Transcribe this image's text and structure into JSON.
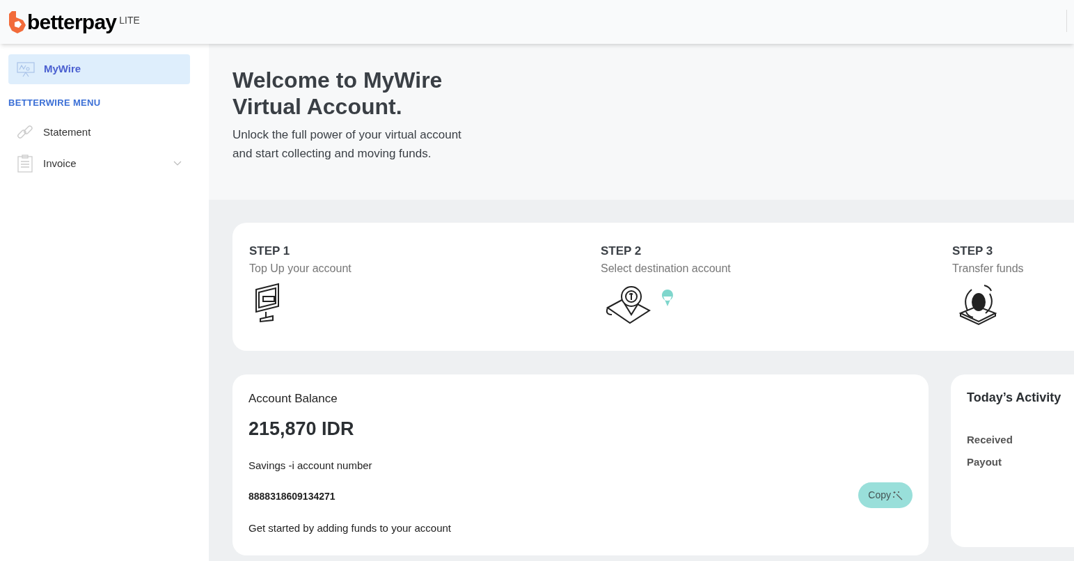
{
  "header": {
    "logo": "betterpay",
    "edition": "LITE"
  },
  "sidebar": {
    "items": [
      {
        "label": "MyWire",
        "kind": "dashboard",
        "selected": true
      }
    ],
    "section_title": "BETTERWIRE MENU",
    "menu": [
      {
        "label": "Statement",
        "kind": "link",
        "selected": false,
        "expandable": false
      },
      {
        "label": "Invoice",
        "kind": "document",
        "selected": false,
        "expandable": true
      }
    ]
  },
  "hero": {
    "title": "Welcome to MyWire Virtual Account.",
    "subtitle": "Unlock the full power of your virtual account and start collecting and moving funds."
  },
  "steps": [
    {
      "title": "STEP 1",
      "text": "Top Up your account",
      "kind": "monitor"
    },
    {
      "title": "STEP 2",
      "text": "Select destination account",
      "kind": "map"
    },
    {
      "title": "STEP 3",
      "text": "Transfer funds",
      "kind": "transfer"
    }
  ],
  "balance": {
    "label": "Account Balance",
    "amount": "215,870 IDR",
    "account_label": "Savings -i account number",
    "account_number": "8888318609134271",
    "hint": "Get started by adding funds to your account",
    "copy_button": "Copy"
  },
  "activity": {
    "title": "Today’s Activity",
    "rows": [
      "Received",
      "Payout"
    ]
  }
}
